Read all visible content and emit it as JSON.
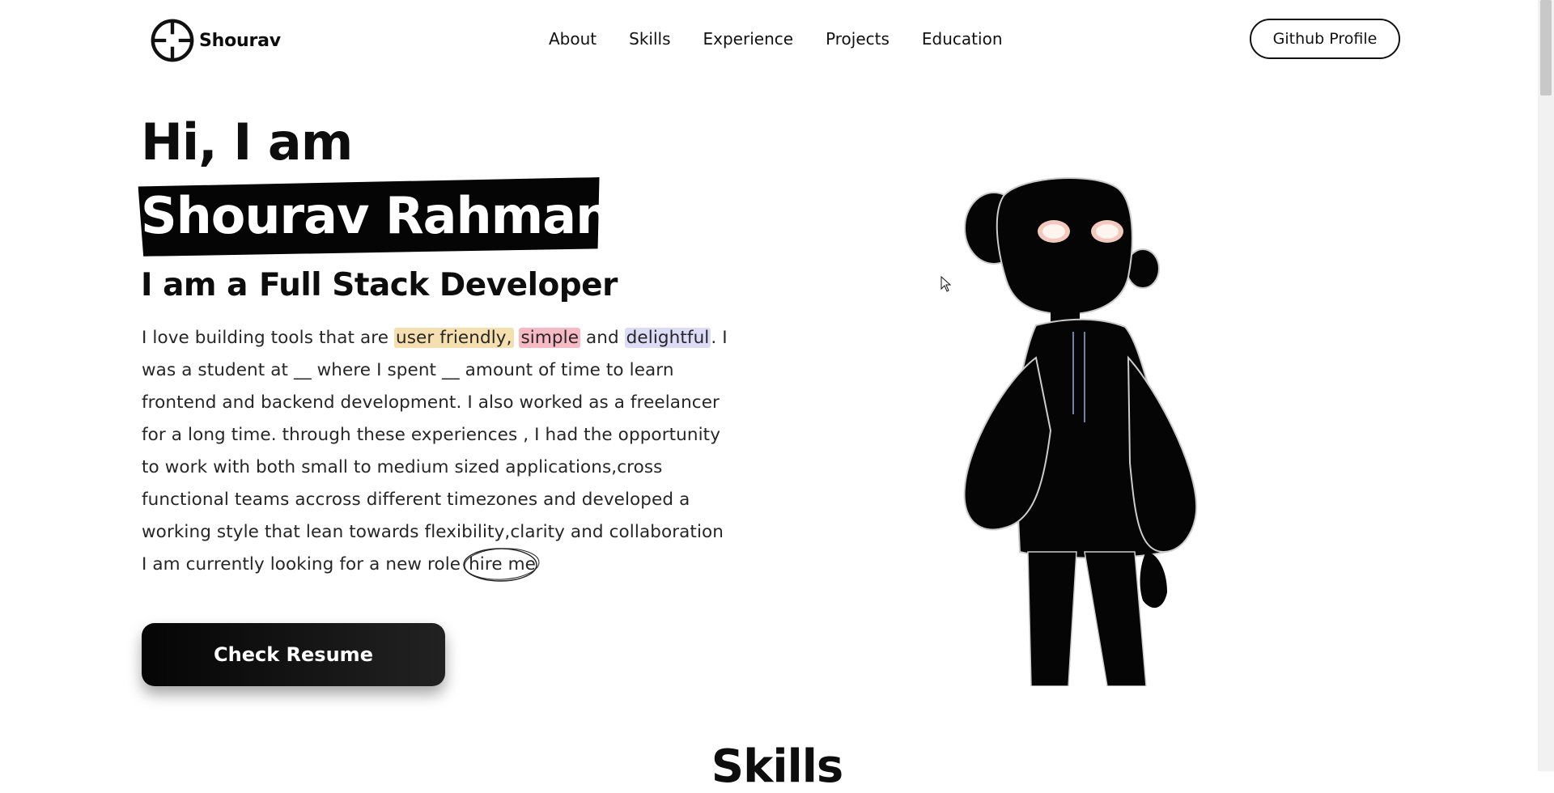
{
  "nav": {
    "logo_text": "Shourav",
    "links": [
      "About",
      "Skills",
      "Experience",
      "Projects",
      "Education"
    ],
    "github_label": "Github Profile"
  },
  "hero": {
    "greeting": "Hi, I am",
    "name": "Shourav Rahman",
    "role_prefix": "I am a",
    "role": "Full Stack Developer",
    "bio": {
      "l1_a": "I love building tools that are ",
      "l1_hl1": "user friendly,",
      "l1_sp": " ",
      "l1_hl2": "simple",
      "l1_b": " and ",
      "l1_hl3": "delightful",
      "l1_c": ". I",
      "l2": "was a student at __ where I spent __ amount of time to learn",
      "l3": "frontend and backend development. I also worked as a freelancer",
      "l4": "for a long time. through these experiences , I had the opportunity",
      "l5": "to work with both small to medium sized applications,cross",
      "l6": "functional teams accross different timezones and developed a",
      "l7": "working style that lean towards flexibility,clarity and collaboration",
      "l8_a": "I am currently looking for a new role ",
      "l8_hire": "hire me"
    },
    "resume_label": "Check Resume"
  },
  "colors": {
    "highlight_yellow": "#f6dfae",
    "highlight_pink": "#f7b9c4",
    "highlight_blue": "#dcdcf7",
    "button_dark": "#050505"
  },
  "icons": {
    "logo": "crosshair-icon",
    "cursor": "mouse-pointer-icon",
    "hero_image": "silhouette-character-illustration"
  },
  "next_section": {
    "title": "Skills"
  }
}
